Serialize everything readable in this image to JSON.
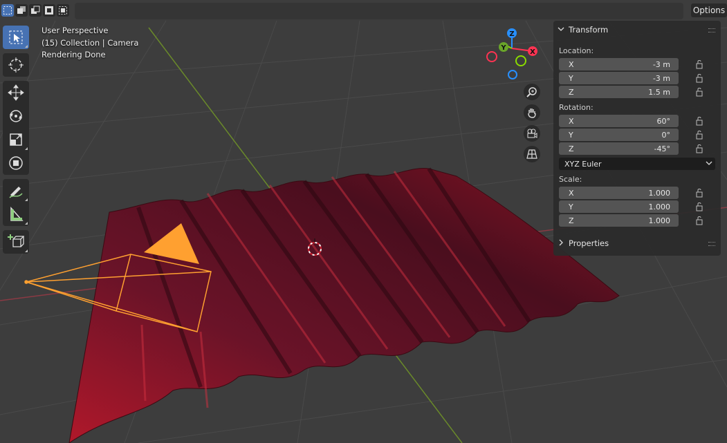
{
  "header": {
    "options_label": "Options",
    "select_modes": [
      "select-new-icon",
      "select-extend-icon",
      "select-subtract-icon",
      "select-invert-icon",
      "select-intersect-icon"
    ]
  },
  "toolbar": {
    "tools": [
      "select-box-icon",
      "cursor-icon",
      "move-icon",
      "rotate-icon",
      "scale-icon",
      "transform-icon",
      "annotate-icon",
      "measure-icon",
      "add-cube-icon"
    ],
    "active": "select-box-icon"
  },
  "viewport": {
    "view_label": "User Perspective",
    "collection_label": "(15) Collection | Camera",
    "status_label": "Rendering Done",
    "surface_color": "#6b1020",
    "camera_color": "#ffa030",
    "axis_x_color": "#ff3352",
    "axis_y_color": "#8bdc00",
    "axis_z_color": "#2890ff"
  },
  "gizmo": {
    "x_label": "X",
    "y_label": "Y",
    "z_label": "Z",
    "nav_buttons": [
      "zoom-icon",
      "pan-hand-icon",
      "camera-view-icon",
      "perspective-grid-icon"
    ]
  },
  "sidebar": {
    "transform_title": "Transform",
    "location_label": "Location:",
    "location": [
      {
        "axis": "X",
        "value": "-3 m"
      },
      {
        "axis": "Y",
        "value": "-3 m"
      },
      {
        "axis": "Z",
        "value": "1.5 m"
      }
    ],
    "rotation_label": "Rotation:",
    "rotation": [
      {
        "axis": "X",
        "value": "60°"
      },
      {
        "axis": "Y",
        "value": "0°"
      },
      {
        "axis": "Z",
        "value": "-45°"
      }
    ],
    "rotation_mode": "XYZ Euler",
    "scale_label": "Scale:",
    "scale": [
      {
        "axis": "X",
        "value": "1.000"
      },
      {
        "axis": "Y",
        "value": "1.000"
      },
      {
        "axis": "Z",
        "value": "1.000"
      }
    ],
    "properties_title": "Properties"
  }
}
